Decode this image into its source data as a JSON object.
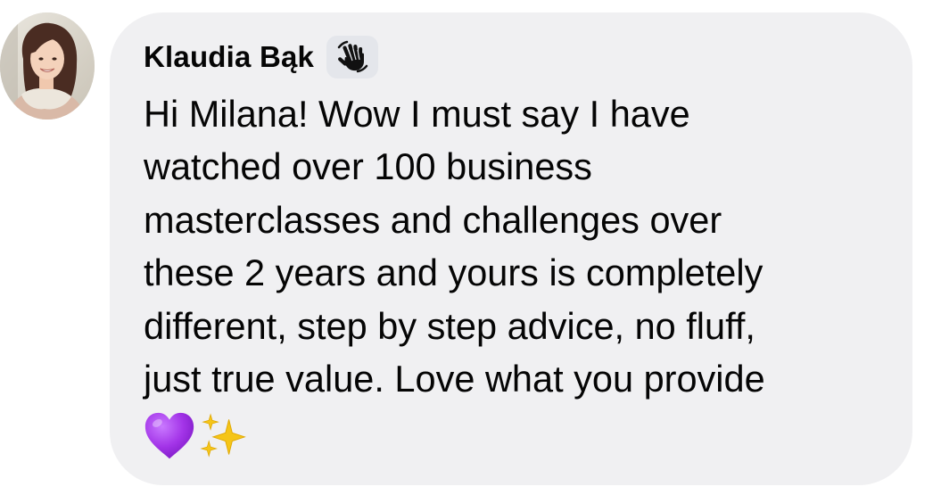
{
  "comment": {
    "author": "Klaudia Bąk",
    "badge_icon": "waving-hand-icon",
    "lines": [
      "Hi Milana! Wow I must say I have",
      "watched over 100 business",
      "masterclasses and challenges over",
      "these 2 years and yours is completely",
      "different, step by step advice, no fluff,",
      "just true value. Love what you provide"
    ],
    "emojis": [
      "purple-heart-icon",
      "sparkles-icon"
    ]
  },
  "colors": {
    "bubble": "#f0f0f2",
    "text": "#050505",
    "badge": "#e4e6eb",
    "heart": "#a334e8",
    "sparkles": "#f5c518"
  }
}
